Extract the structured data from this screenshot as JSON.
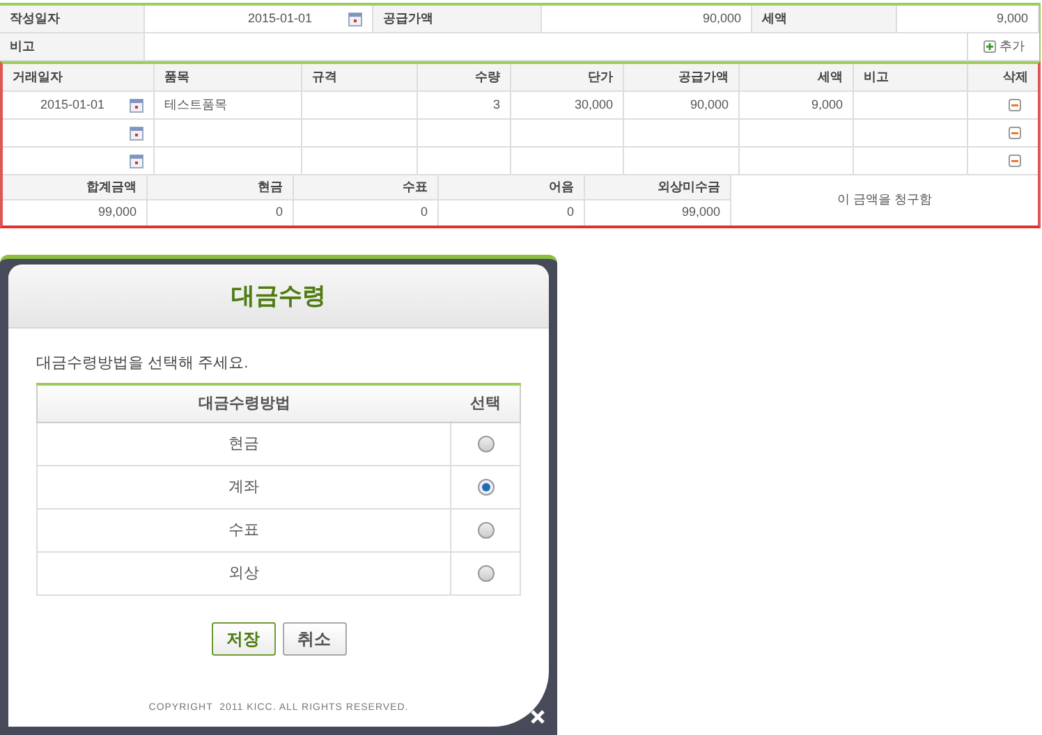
{
  "form": {
    "fields": [
      {
        "label": "작성일자",
        "value": "2015-01-01",
        "kind": "date"
      },
      {
        "label": "공급가액",
        "value": "90,000",
        "kind": "text"
      },
      {
        "label": "세액",
        "value": "9,000",
        "kind": "text"
      }
    ],
    "memo": {
      "label": "비고",
      "add_button": "추가"
    }
  },
  "items": {
    "columns": [
      "거래일자",
      "품목",
      "규격",
      "수량",
      "단가",
      "공급가액",
      "세액",
      "비고",
      "삭제"
    ],
    "rows": [
      {
        "date": "2015-01-01",
        "item": "테스트품목",
        "qty": "3",
        "unit_price": "30,000",
        "supply": "90,000",
        "tax": "9,000"
      },
      {},
      {}
    ]
  },
  "summary": {
    "columns": [
      "합계금액",
      "현금",
      "수표",
      "어음",
      "외상미수금"
    ],
    "values": [
      "99,000",
      "0",
      "0",
      "0",
      "99,000"
    ],
    "note": "이 금액을 청구함"
  },
  "dialog": {
    "title": "대금수령",
    "prompt": "대금수령방법을 선택해 주세요.",
    "columns": [
      "대금수령방법",
      "선택"
    ],
    "options": [
      {
        "label": "현금",
        "selected": false
      },
      {
        "label": "계좌",
        "selected": true
      },
      {
        "label": "수표",
        "selected": false
      },
      {
        "label": "외상",
        "selected": false
      }
    ],
    "buttons": [
      {
        "label": "저장",
        "kind": "primary"
      },
      {
        "label": "취소",
        "kind": "default"
      }
    ],
    "copyright": "COPYRIGHT  2011 KICC. ALL RIGHTS RESERVED."
  }
}
